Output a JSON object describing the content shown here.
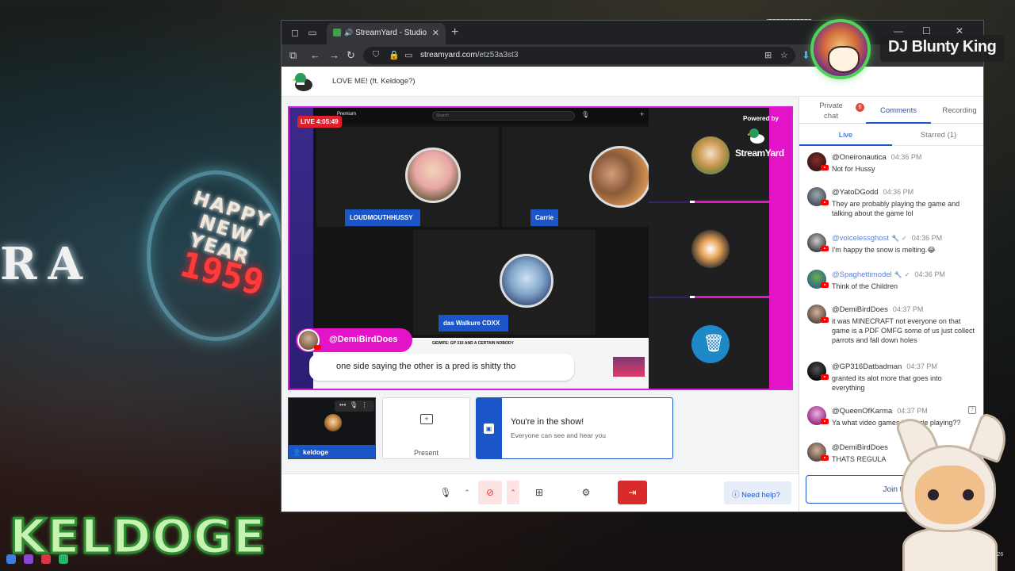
{
  "overlay": {
    "dj_name": "DJ Blunty King",
    "channel_logo": "KELDOGE",
    "sign_happy": "HAPPY",
    "sign_new_year": "NEW YEAR",
    "sign_year": "1959",
    "sign_ra": "RA",
    "taskbar_date": "14/2026"
  },
  "browser": {
    "tab_title": "StreamYard - Studio",
    "url_host": "streamyard.com",
    "url_path": "/etz53a3st3",
    "accent": "#4ea8ff"
  },
  "studio": {
    "broadcast_title": "LOVE ME! (ft. Keldoge?)",
    "live_badge": "LIVE 4:05:49",
    "powered_by": "Powered by",
    "streamyard_logo": "StreamYard",
    "screen_search_placeholder": "Search",
    "screen_yt_label": "Premium",
    "screen_strip_title": "GEWIFE: GP 316 AND A CERTAIN NOBODY",
    "participants": [
      {
        "label": "LOUDMOUTHHUSSY"
      },
      {
        "label": "Carrie"
      },
      {
        "label": "das Walkure CDXX"
      }
    ],
    "featured_comment": {
      "author": "@DemiBirdDoes",
      "text": "one side saying the other is a pred is shitty tho"
    },
    "self_tile_name": "keldoge",
    "present_label": "Present",
    "in_show_title": "You're in the show!",
    "in_show_sub": "Everyone can see and hear you",
    "help_label": "Need help?",
    "brand_magenta": "#e313c8",
    "brand_blue": "#1a56c8",
    "live_red": "#e01f2d"
  },
  "panel": {
    "tabs": {
      "private_line1": "Private",
      "private_line2": "chat",
      "private_badge": "6",
      "comments": "Comments",
      "recording": "Recording"
    },
    "subtabs": {
      "live": "Live",
      "starred": "Starred (1)"
    },
    "comments": [
      {
        "author": "@Oneironautica",
        "time": "04:36 PM",
        "text": "Not for Hussy"
      },
      {
        "author": "@YatoDGodd",
        "time": "04:36 PM",
        "text": "They are probably playing the game and talking about the game lol"
      },
      {
        "author": "@voicelessghost",
        "time": "04:36 PM",
        "text": "I'm happy the snow is melting.😂"
      },
      {
        "author": "@Spaghettimodel",
        "time": "04:36 PM",
        "text": "Think of the Children"
      },
      {
        "author": "@DemiBirdDoes",
        "time": "04:37 PM",
        "text": "it was MINECRAFT not everyone on that game is a PDF OMFG some of us just collect parrots and fall down holes"
      },
      {
        "author": "@GP316Datbadman",
        "time": "04:37 PM",
        "text": "granted its alot more that goes into everything"
      },
      {
        "author": "@QueenOfKarma",
        "time": "04:37 PM",
        "text": "Ya what video games is Carrie playing??"
      },
      {
        "author": "@DemiBirdDoes",
        "time": "",
        "text": "THATS REGULA"
      }
    ],
    "join_label": "Join t"
  }
}
